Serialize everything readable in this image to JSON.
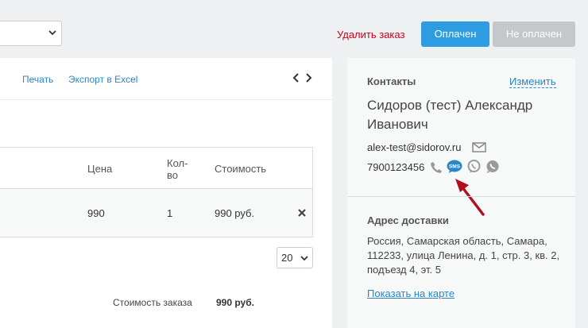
{
  "top": {
    "delete_order": "Удалить заказ",
    "paid_button": "Оплачен",
    "unpaid_button": "Не оплачен"
  },
  "toolbar": {
    "print": "Печать",
    "export": "Экспорт в Excel"
  },
  "table": {
    "headers": {
      "price": "Цена",
      "qty_line1": "Кол-",
      "qty_line2": "во",
      "cost": "Стоимость"
    },
    "rows": [
      {
        "price": "990",
        "qty": "1",
        "cost": "990 руб."
      }
    ]
  },
  "pagination": {
    "page_size": "20"
  },
  "summary": {
    "label": "Стоимость заказа",
    "value": "990 руб."
  },
  "contacts": {
    "title": "Контакты",
    "edit": "Изменить",
    "name": "Сидоров (тест) Александр Иванович",
    "email": "alex-test@sidorov.ru",
    "phone": "7900123456",
    "sms_label": "SMS"
  },
  "delivery": {
    "title": "Адрес доставки",
    "address": "Россия, Самарская область, Самара, 112233, улица Ленина, д. 1, стр. 3, кв. 2, подъезд 4, эт. 5",
    "map_link": "Показать на карте"
  },
  "colors": {
    "accent": "#2d9ce0",
    "danger": "#d0021b",
    "link": "#2a86c8",
    "annotation_arrow": "#b0101c"
  }
}
